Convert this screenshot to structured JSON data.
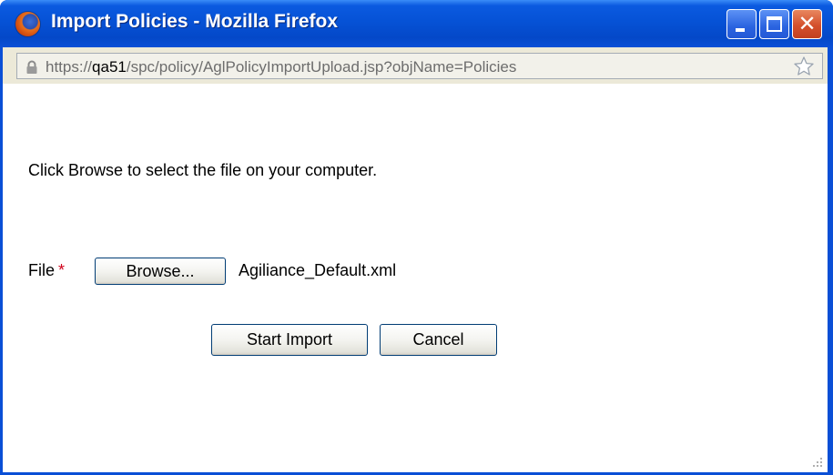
{
  "window": {
    "title": "Import Policies - Mozilla Firefox"
  },
  "address_bar": {
    "url_prefix": "https://",
    "url_host": "qa51",
    "url_path": "/spc/policy/AglPolicyImportUpload.jsp?objName=Policies"
  },
  "dialog": {
    "instructions": "Click Browse to select the file on your computer.",
    "file_label": "File",
    "required_marker": "*",
    "browse_label": "Browse...",
    "selected_file": "Agiliance_Default.xml",
    "start_import_label": "Start Import",
    "cancel_label": "Cancel"
  },
  "icons": {
    "app": "firefox-icon",
    "minimize": "minimize-icon",
    "maximize": "maximize-icon",
    "close": "close-icon",
    "lock": "lock-icon",
    "bookmark": "star-icon",
    "resize": "resize-grip-icon"
  },
  "colors": {
    "titlebar": "#0652d6",
    "close_button": "#d4502c",
    "required": "#d0021b",
    "button_border": "#003c74"
  }
}
